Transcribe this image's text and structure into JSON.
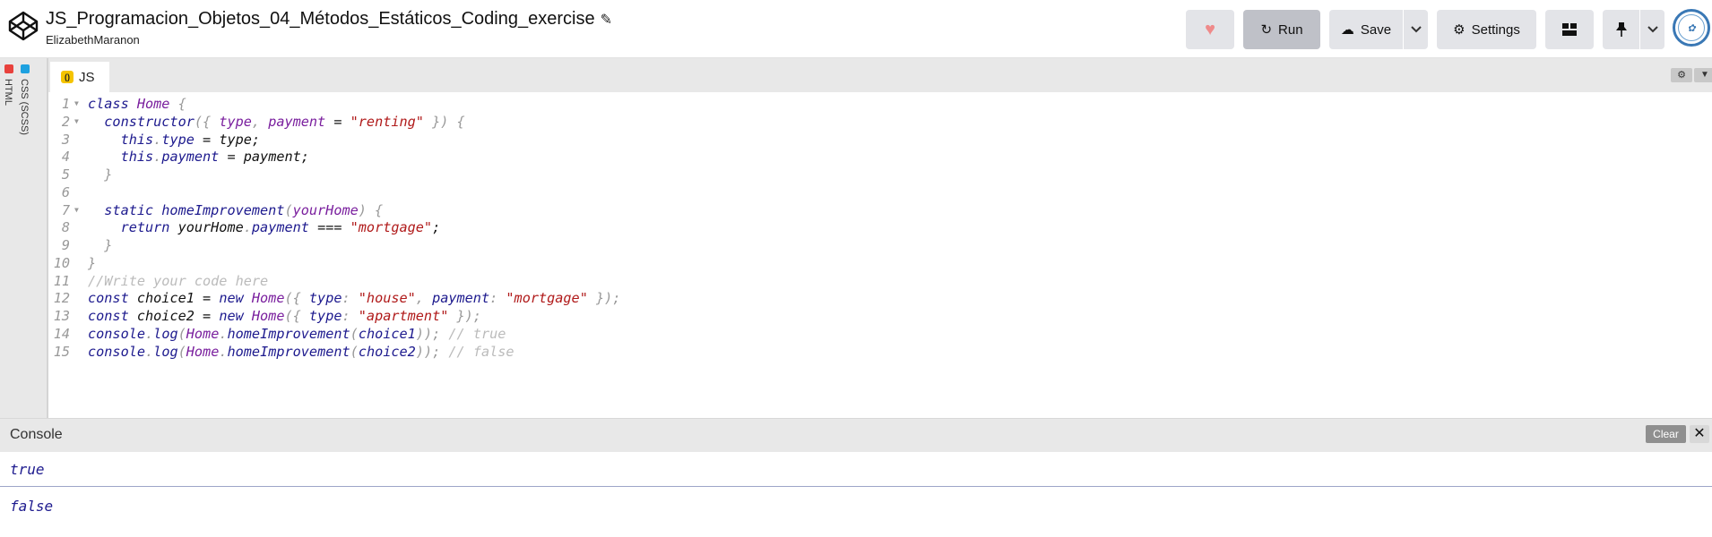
{
  "header": {
    "title": "JS_Programacion_Objetos_04_Métodos_Estáticos_Coding_exercise",
    "author": "ElizabethMaranon",
    "buttons": {
      "run": "Run",
      "save": "Save",
      "settings": "Settings"
    },
    "icons": [
      "codepen-logo-icon",
      "pencil-icon",
      "heart-icon",
      "refresh-icon",
      "cloud-icon",
      "chevron-down-icon",
      "gear-icon",
      "layout-icon",
      "pin-icon",
      "avatar"
    ]
  },
  "side_tabs": [
    {
      "label": "HTML",
      "color": "#e8413c"
    },
    {
      "label": "CSS (SCSS)",
      "color": "#1da1e0"
    }
  ],
  "editor": {
    "tab_label": "JS",
    "badge_color": "#f5c400",
    "lines": [
      {
        "n": "1",
        "fold": true,
        "tokens": [
          [
            "k",
            "class "
          ],
          [
            "v",
            "Home "
          ],
          [
            "p",
            "{"
          ]
        ]
      },
      {
        "n": "2",
        "fold": true,
        "tokens": [
          [
            "k",
            "  constructor"
          ],
          [
            "p",
            "({ "
          ],
          [
            "v",
            "type"
          ],
          [
            "p",
            ", "
          ],
          [
            "v",
            "payment"
          ],
          [
            "n",
            " = "
          ],
          [
            "s",
            "\"renting\""
          ],
          [
            "p",
            " }) {"
          ]
        ]
      },
      {
        "n": "3",
        "fold": false,
        "tokens": [
          [
            "k",
            "    this"
          ],
          [
            "p",
            "."
          ],
          [
            "k",
            "type"
          ],
          [
            "n",
            " = type;"
          ]
        ]
      },
      {
        "n": "4",
        "fold": false,
        "tokens": [
          [
            "k",
            "    this"
          ],
          [
            "p",
            "."
          ],
          [
            "k",
            "payment"
          ],
          [
            "n",
            " = payment;"
          ]
        ]
      },
      {
        "n": "5",
        "fold": false,
        "tokens": [
          [
            "p",
            "  }"
          ]
        ]
      },
      {
        "n": "6",
        "fold": false,
        "tokens": []
      },
      {
        "n": "7",
        "fold": true,
        "tokens": [
          [
            "k",
            "  static homeImprovement"
          ],
          [
            "p",
            "("
          ],
          [
            "v",
            "yourHome"
          ],
          [
            "p",
            ") {"
          ]
        ]
      },
      {
        "n": "8",
        "fold": false,
        "tokens": [
          [
            "k",
            "    return "
          ],
          [
            "n",
            "yourHome"
          ],
          [
            "p",
            "."
          ],
          [
            "k",
            "payment"
          ],
          [
            "n",
            " === "
          ],
          [
            "s",
            "\"mortgage\""
          ],
          [
            "n",
            ";"
          ]
        ]
      },
      {
        "n": "9",
        "fold": false,
        "tokens": [
          [
            "p",
            "  }"
          ]
        ]
      },
      {
        "n": "10",
        "fold": false,
        "tokens": [
          [
            "p",
            "}"
          ]
        ]
      },
      {
        "n": "11",
        "fold": false,
        "tokens": [
          [
            "c",
            "//Write your code here"
          ]
        ]
      },
      {
        "n": "12",
        "fold": false,
        "tokens": [
          [
            "k",
            "const "
          ],
          [
            "n",
            "choice1 = "
          ],
          [
            "k",
            "new "
          ],
          [
            "v",
            "Home"
          ],
          [
            "p",
            "({ "
          ],
          [
            "k",
            "type"
          ],
          [
            "p",
            ": "
          ],
          [
            "s",
            "\"house\""
          ],
          [
            "p",
            ", "
          ],
          [
            "k",
            "payment"
          ],
          [
            "p",
            ": "
          ],
          [
            "s",
            "\"mortgage\""
          ],
          [
            "p",
            " });"
          ]
        ]
      },
      {
        "n": "13",
        "fold": false,
        "tokens": [
          [
            "k",
            "const "
          ],
          [
            "n",
            "choice2 = "
          ],
          [
            "k",
            "new "
          ],
          [
            "v",
            "Home"
          ],
          [
            "p",
            "({ "
          ],
          [
            "k",
            "type"
          ],
          [
            "p",
            ": "
          ],
          [
            "s",
            "\"apartment\""
          ],
          [
            "p",
            " });"
          ]
        ]
      },
      {
        "n": "14",
        "fold": false,
        "tokens": [
          [
            "k",
            "console"
          ],
          [
            "p",
            "."
          ],
          [
            "k",
            "log"
          ],
          [
            "p",
            "("
          ],
          [
            "v",
            "Home"
          ],
          [
            "p",
            "."
          ],
          [
            "k",
            "homeImprovement"
          ],
          [
            "p",
            "("
          ],
          [
            "k",
            "choice1"
          ],
          [
            "p",
            "));"
          ],
          [
            "c",
            " // true"
          ]
        ]
      },
      {
        "n": "15",
        "fold": false,
        "tokens": [
          [
            "k",
            "console"
          ],
          [
            "p",
            "."
          ],
          [
            "k",
            "log"
          ],
          [
            "p",
            "("
          ],
          [
            "v",
            "Home"
          ],
          [
            "p",
            "."
          ],
          [
            "k",
            "homeImprovement"
          ],
          [
            "p",
            "("
          ],
          [
            "k",
            "choice2"
          ],
          [
            "p",
            "));"
          ],
          [
            "c",
            " // false"
          ]
        ]
      }
    ]
  },
  "console": {
    "title": "Console",
    "clear_label": "Clear",
    "output": [
      "true",
      "false"
    ]
  }
}
